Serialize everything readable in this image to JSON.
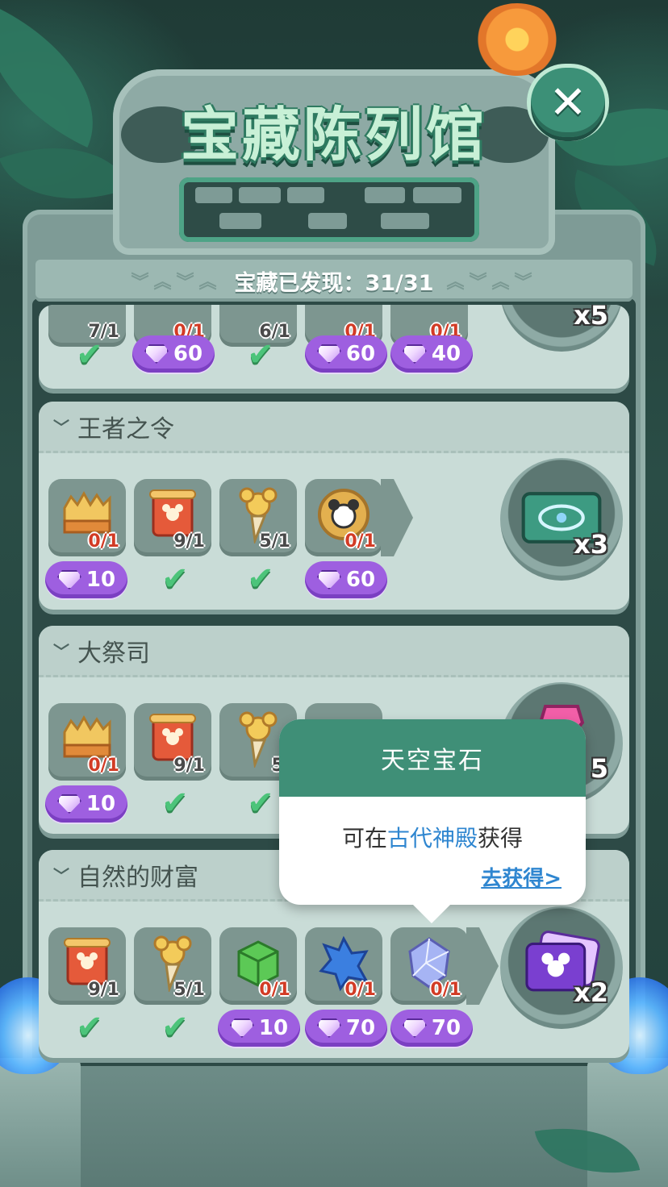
{
  "header": {
    "title": "宝藏陈列馆",
    "close_glyph": "✕",
    "discovered_label": "宝藏已发现：31/31"
  },
  "top_row": {
    "counts": [
      "7/1",
      "0/1",
      "6/1",
      "0/1",
      "0/1"
    ],
    "statuses": [
      {
        "type": "check"
      },
      {
        "type": "price",
        "value": "60"
      },
      {
        "type": "check"
      },
      {
        "type": "price",
        "value": "60"
      },
      {
        "type": "price",
        "value": "40"
      }
    ],
    "reward_multiplier": "x5"
  },
  "sections": [
    {
      "name": "王者之令",
      "items": [
        {
          "icon": "crown-icon",
          "count": "0/1",
          "status": "price",
          "price": "10"
        },
        {
          "icon": "mickey-banner-icon",
          "count": "9/1",
          "status": "check"
        },
        {
          "icon": "mickey-torch-icon",
          "count": "5/1",
          "status": "check"
        },
        {
          "icon": "gold-coin-icon",
          "count": "0/1",
          "status": "price",
          "price": "60"
        }
      ],
      "reward": {
        "icon": "spiral-ticket-icon",
        "multiplier": "x3"
      }
    },
    {
      "name": "大祭司",
      "items": [
        {
          "icon": "crown-icon",
          "count": "0/1",
          "status": "price",
          "price": "10"
        },
        {
          "icon": "mickey-banner-icon",
          "count": "9/1",
          "status": "check"
        },
        {
          "icon": "mickey-torch-icon",
          "count": "5/",
          "status": "check"
        }
      ],
      "reward": {
        "icon": "pink-gem-icon",
        "multiplier": "5"
      }
    },
    {
      "name": "自然的财富",
      "items": [
        {
          "icon": "mickey-banner-icon",
          "count": "9/1",
          "status": "check"
        },
        {
          "icon": "mickey-torch-icon",
          "count": "5/1",
          "status": "check"
        },
        {
          "icon": "green-cube-icon",
          "count": "0/1",
          "status": "price",
          "price": "10"
        },
        {
          "icon": "blue-crystal-icon",
          "count": "0/1",
          "status": "price",
          "price": "70"
        },
        {
          "icon": "sky-gem-icon",
          "count": "0/1",
          "status": "price",
          "price": "70"
        }
      ],
      "reward": {
        "icon": "star-card-icon",
        "multiplier": "x2"
      }
    }
  ],
  "tooltip": {
    "title": "天空宝石",
    "prefix": "可在",
    "location": "古代神殿",
    "suffix": "获得",
    "link": "去获得>"
  },
  "colors": {
    "accent_green": "#3f8f77",
    "price_purple": "#9e5fe0",
    "count_red": "#d23b25",
    "link_blue": "#2f86d0"
  }
}
